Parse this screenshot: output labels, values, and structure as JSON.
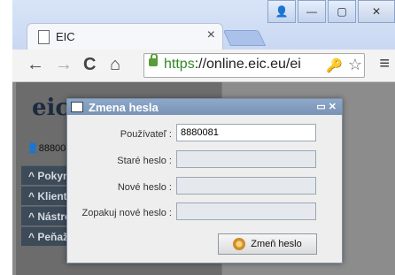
{
  "browser": {
    "tab_title": "EIC",
    "tab_close": "×",
    "window_buttons": {
      "user": "👤",
      "minimize": "—",
      "maximize": "▢",
      "close": "✕"
    },
    "nav": {
      "back": "←",
      "forward": "→",
      "reload": "C",
      "home": "⌂"
    },
    "url": {
      "scheme": "https",
      "rest": "://online.eic.eu/ei"
    }
  },
  "app": {
    "logo": "eic",
    "user_id": "8880081",
    "menu": [
      {
        "label": "Pokyn"
      },
      {
        "label": "Klient"
      },
      {
        "label": "Nástro"
      },
      {
        "label": "Peňaž"
      }
    ]
  },
  "dialog": {
    "title": "Zmena hesla",
    "fields": {
      "user": {
        "label": "Používateľ :",
        "value": "8880081"
      },
      "old": {
        "label": "Staré heslo :",
        "value": ""
      },
      "new": {
        "label": "Nové heslo :",
        "value": ""
      },
      "repeat": {
        "label": "Zopakuj nové heslo :",
        "value": ""
      }
    },
    "submit_label": "Zmeň heslo"
  }
}
